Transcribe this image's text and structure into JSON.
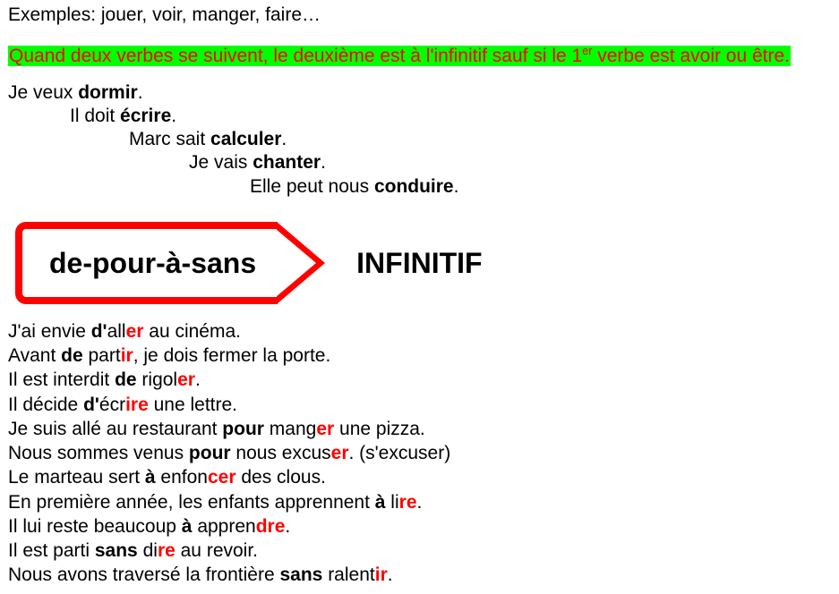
{
  "top": {
    "examples": "Exemples: jouer, voir, manger, faire…"
  },
  "rule": {
    "t1": "Quand deux verbes se suivent, le deuxième est à l'infinitif sauf si le 1",
    "super": "er",
    "t2": " verbe est avoir ou être."
  },
  "stagger": {
    "l1a": "Je veux ",
    "l1b": "dormir",
    "l1c": ".",
    "l2a": "Il doit ",
    "l2b": "écrire",
    "l2c": ".",
    "l3a": "Marc sait ",
    "l3b": "calculer",
    "l3c": ".",
    "l4a": "Je vais ",
    "l4b": "chanter",
    "l4c": ".",
    "l5a": "Elle peut nous ",
    "l5b": "conduire",
    "l5c": "."
  },
  "arrow": {
    "text": "de-pour-à-sans",
    "label": "INFINITIF"
  },
  "ex": {
    "l1a": "J'ai envie ",
    "l1b": "d'",
    "l1c": "all",
    "l1d": "er",
    "l1e": " au cinéma.",
    "l2a": "Avant ",
    "l2b": "de",
    "l2c": " part",
    "l2d": "ir",
    "l2e": ", je dois fermer la porte.",
    "l3a": "Il est interdit ",
    "l3b": "de",
    "l3c": " rigol",
    "l3d": "er",
    "l3e": ".",
    "l4a": "Il décide ",
    "l4b": "d'",
    "l4c": "écr",
    "l4d": "ire",
    "l4e": " une lettre.",
    "l5a": "Je suis allé au restaurant ",
    "l5b": "pour",
    "l5c": " mang",
    "l5d": "er",
    "l5e": " une pizza.",
    "l6a": "Nous sommes venus ",
    "l6b": "pour",
    "l6c": " nous excus",
    "l6d": "er",
    "l6e": ". (s'excuser)",
    "l7a": "Le marteau sert ",
    "l7b": "à",
    "l7c": " enfon",
    "l7d": "cer",
    "l7e": " des clous.",
    "l8a": "En première année, les enfants apprennent ",
    "l8b": "à",
    "l8c": " li",
    "l8d": "re",
    "l8e": ".",
    "l9a": "Il lui reste beaucoup ",
    "l9b": "à",
    "l9c": " appren",
    "l9d": "dre",
    "l9e": ".",
    "l10a": "Il est parti ",
    "l10b": "sans",
    "l10c": " di",
    "l10d": "re",
    "l10e": " au revoir.",
    "l11a": "Nous avons traversé la frontière ",
    "l11b": "sans",
    "l11c": " ralent",
    "l11d": "ir",
    "l11e": "."
  }
}
